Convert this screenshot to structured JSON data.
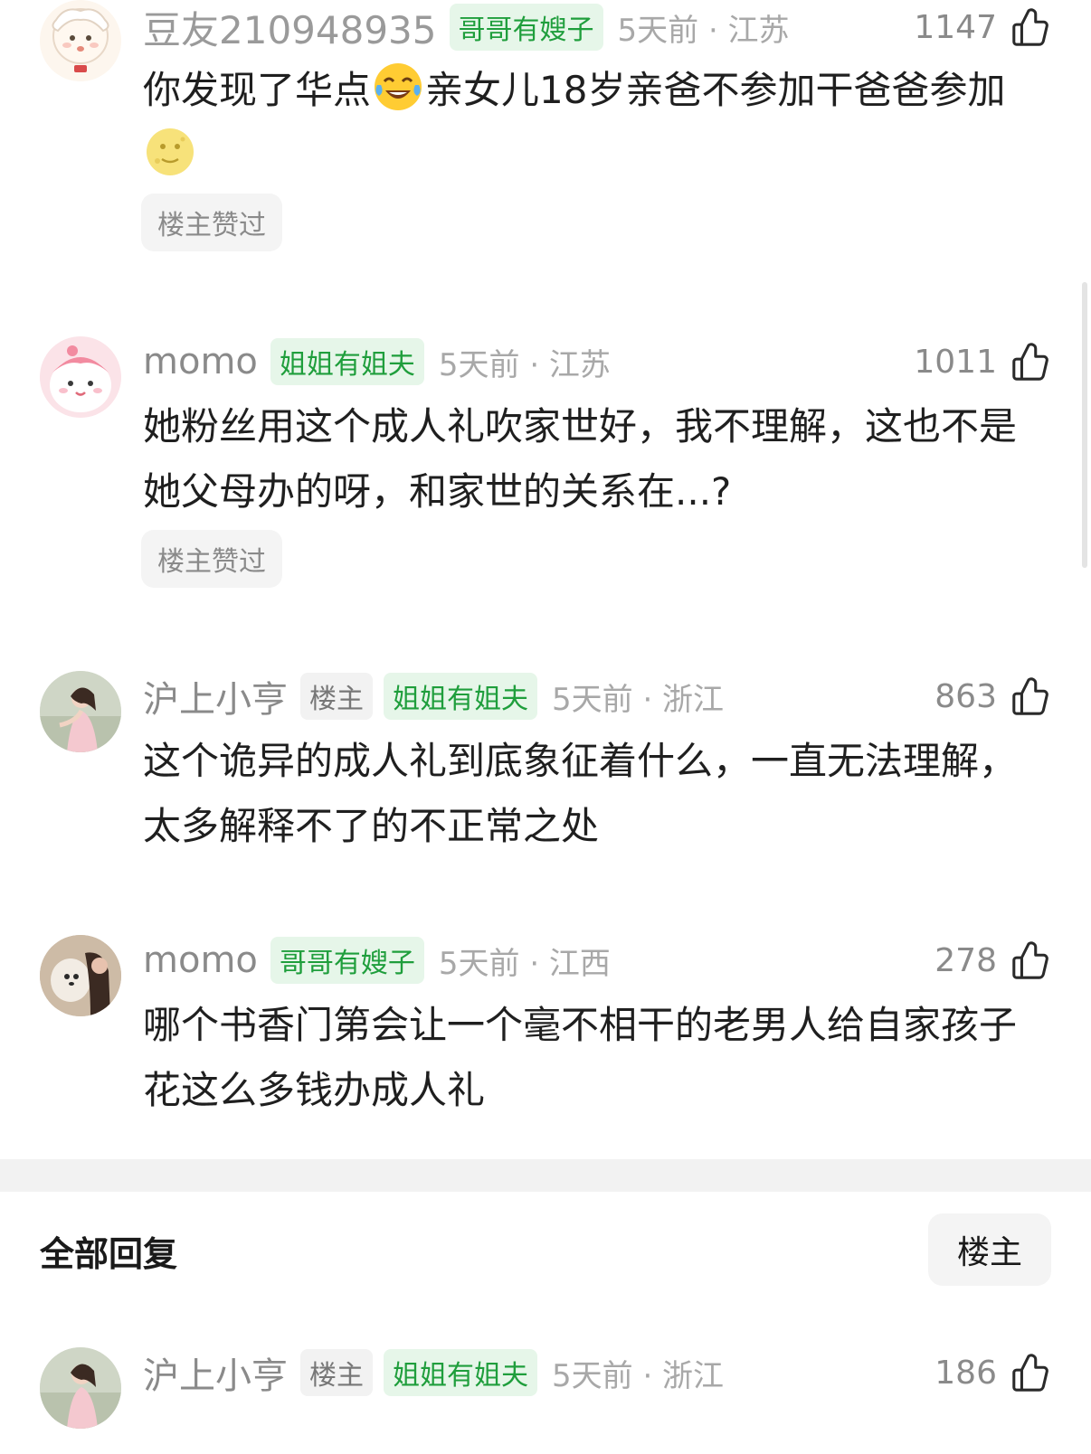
{
  "comments": [
    {
      "username": "豆友210948935",
      "group_tag": "哥哥有嫂子",
      "time_location": "5天前 · 江苏",
      "likes": "1147",
      "text_1": "你发现了华点",
      "emoji_1": "tears-of-joy-emoji",
      "text_2": "亲女儿18岁亲爸不参加干爸爸参加",
      "emoji_2": "full-moon-face-emoji",
      "liked_by_op": "楼主赞过"
    },
    {
      "username": "momo",
      "group_tag": "姐姐有姐夫",
      "time_location": "5天前 · 江苏",
      "likes": "1011",
      "text": "她粉丝用这个成人礼吹家世好，我不理解，这也不是她父母办的呀，和家世的关系在...?",
      "liked_by_op": "楼主赞过"
    },
    {
      "username": "沪上小亨",
      "op_tag": "楼主",
      "group_tag": "姐姐有姐夫",
      "time_location": "5天前 · 浙江",
      "likes": "863",
      "text": "这个诡异的成人礼到底象征着什么，一直无法理解，太多解释不了的不正常之处"
    },
    {
      "username": "momo",
      "group_tag": "哥哥有嫂子",
      "time_location": "5天前 · 江西",
      "likes": "278",
      "text": "哪个书香门第会让一个毫不相干的老男人给自家孩子花这么多钱办成人礼"
    }
  ],
  "replies_section": {
    "title": "全部回复",
    "filter_button": "楼主"
  },
  "reply": {
    "username": "沪上小亨",
    "op_tag": "楼主",
    "group_tag": "姐姐有姐夫",
    "time_location": "5天前 · 浙江",
    "likes": "186"
  },
  "colors": {
    "group_tag_text": "#1f9e3c",
    "group_tag_bg": "#e6f6e9",
    "meta_gray": "#8a8a8a"
  }
}
